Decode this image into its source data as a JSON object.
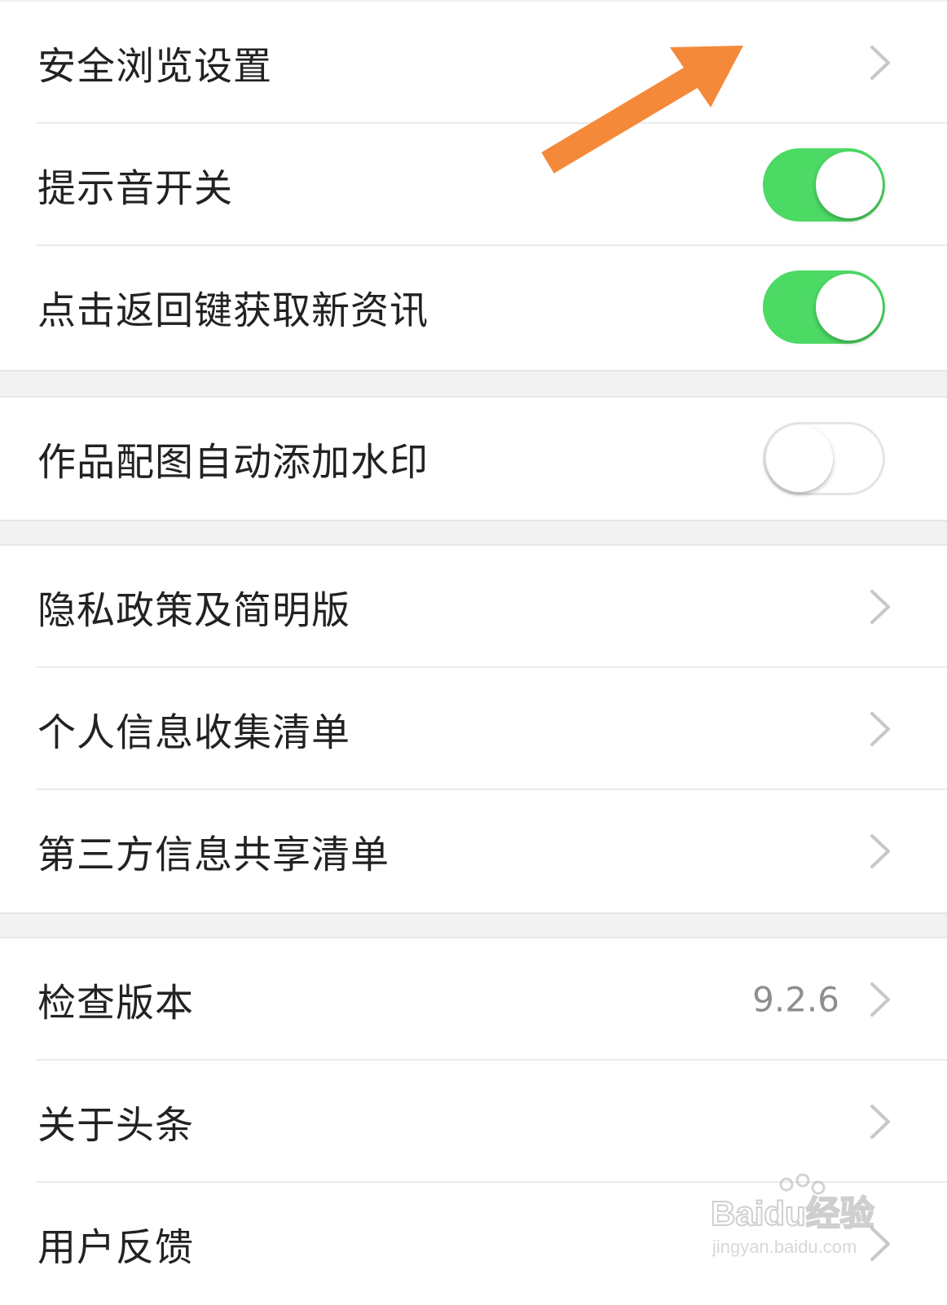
{
  "settings": {
    "group1": [
      {
        "label": "安全浏览设置",
        "control": "chevron"
      },
      {
        "label": "提示音开关",
        "control": "toggle",
        "on": true
      },
      {
        "label": "点击返回键获取新资讯",
        "control": "toggle",
        "on": true
      }
    ],
    "group2": [
      {
        "label": "作品配图自动添加水印",
        "control": "toggle",
        "on": false
      }
    ],
    "group3": [
      {
        "label": "隐私政策及简明版",
        "control": "chevron"
      },
      {
        "label": "个人信息收集清单",
        "control": "chevron"
      },
      {
        "label": "第三方信息共享清单",
        "control": "chevron"
      }
    ],
    "group4": [
      {
        "label": "检查版本",
        "control": "chevron",
        "value": "9.2.6"
      },
      {
        "label": "关于头条",
        "control": "chevron"
      },
      {
        "label": "用户反馈",
        "control": "chevron"
      }
    ]
  },
  "colors": {
    "toggle_on": "#4cd964",
    "annotation_arrow": "#f5893a"
  },
  "watermark": {
    "brand": "Baidu经验",
    "url": "jingyan.baidu.com"
  }
}
